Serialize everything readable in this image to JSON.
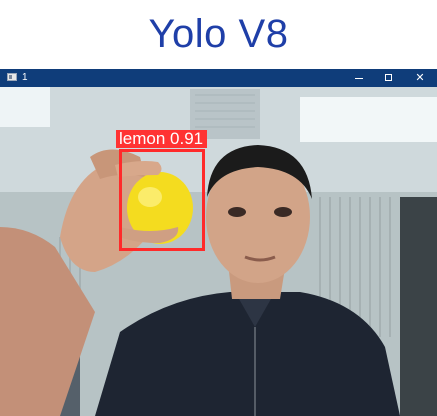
{
  "page": {
    "heading": "Yolo V8"
  },
  "window": {
    "title": "1",
    "controls": {
      "minimize_icon": "minimize-icon",
      "maximize_icon": "maximize-icon",
      "close_icon": "close-icon",
      "close_glyph": "✕"
    }
  },
  "detection": {
    "class_name": "lemon",
    "confidence": "0.91",
    "label_text": "lemon  0.91",
    "box_color": "#ff2a2a"
  },
  "colors": {
    "heading": "#1f3fa8",
    "titlebar": "#0f3d7a"
  }
}
